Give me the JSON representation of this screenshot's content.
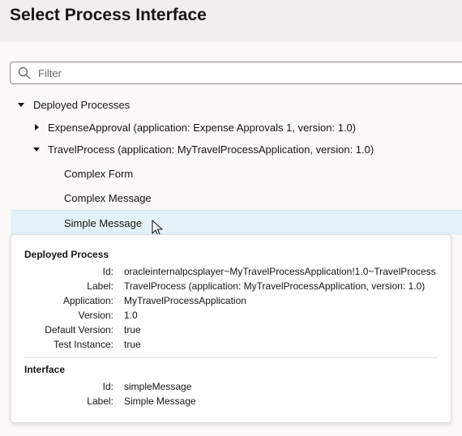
{
  "header": {
    "title": "Select Process Interface"
  },
  "filter": {
    "placeholder": "Filter",
    "value": ""
  },
  "tree": {
    "root": {
      "label": "Deployed Processes"
    },
    "process1": {
      "label": "ExpenseApproval (application: Expense Approvals 1, version: 1.0)"
    },
    "process2": {
      "label": "TravelProcess (application: MyTravelProcessApplication, version: 1.0)"
    },
    "interfaces": [
      {
        "label": "Complex Form"
      },
      {
        "label": "Complex Message"
      },
      {
        "label": "Simple Message"
      }
    ]
  },
  "popup": {
    "process_title": "Deployed Process",
    "process_fields": [
      {
        "key": "Id:",
        "value": "oracleinternalpcsplayer~MyTravelProcessApplication!1.0~TravelProcess"
      },
      {
        "key": "Label:",
        "value": "TravelProcess (application: MyTravelProcessApplication, version: 1.0)"
      },
      {
        "key": "Application:",
        "value": "MyTravelProcessApplication"
      },
      {
        "key": "Version:",
        "value": "1.0"
      },
      {
        "key": "Default Version:",
        "value": "true"
      },
      {
        "key": "Test Instance:",
        "value": "true"
      }
    ],
    "interface_title": "Interface",
    "interface_fields": [
      {
        "key": "Id:",
        "value": "simpleMessage"
      },
      {
        "key": "Label:",
        "value": "Simple Message"
      }
    ]
  }
}
